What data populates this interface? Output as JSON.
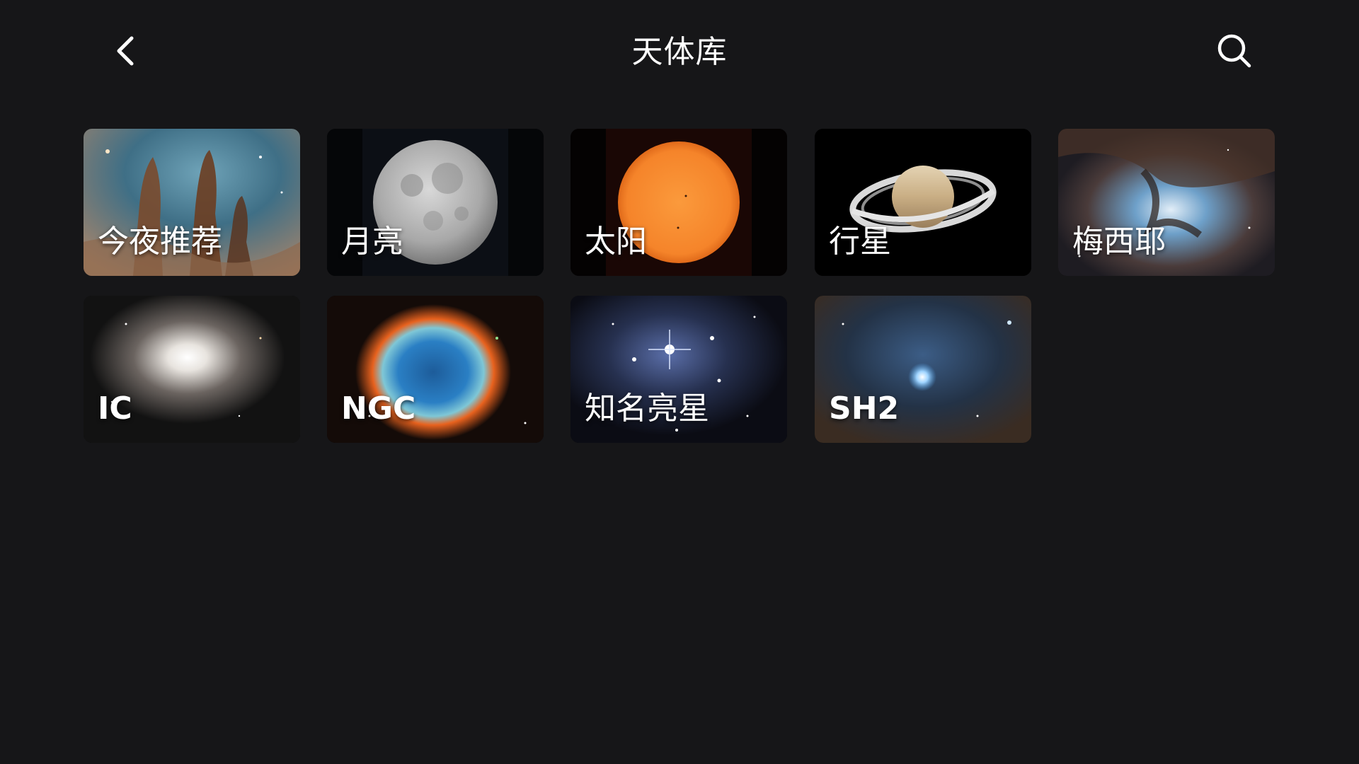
{
  "header": {
    "title": "天体库",
    "back_icon": "chevron-left-icon",
    "search_icon": "search-icon"
  },
  "categories": [
    {
      "key": "tonight",
      "label": "今夜推荐",
      "image": "pillars-of-creation"
    },
    {
      "key": "moon",
      "label": "月亮",
      "image": "full-moon"
    },
    {
      "key": "sun",
      "label": "太阳",
      "image": "sun"
    },
    {
      "key": "planets",
      "label": "行星",
      "image": "saturn"
    },
    {
      "key": "messier",
      "label": "梅西耶",
      "image": "nebula"
    },
    {
      "key": "ic",
      "label": "IC",
      "image": "globular-cluster"
    },
    {
      "key": "ngc",
      "label": "NGC",
      "image": "helix-nebula"
    },
    {
      "key": "bright_stars",
      "label": "知名亮星",
      "image": "pleiades"
    },
    {
      "key": "sh2",
      "label": "SH2",
      "image": "blue-star-nebula"
    }
  ],
  "colors": {
    "background": "#161618",
    "text": "#ffffff",
    "sun": "#f58a2f",
    "nebula_blue": "#2a7fc4",
    "nebula_orange": "#e8621e"
  }
}
